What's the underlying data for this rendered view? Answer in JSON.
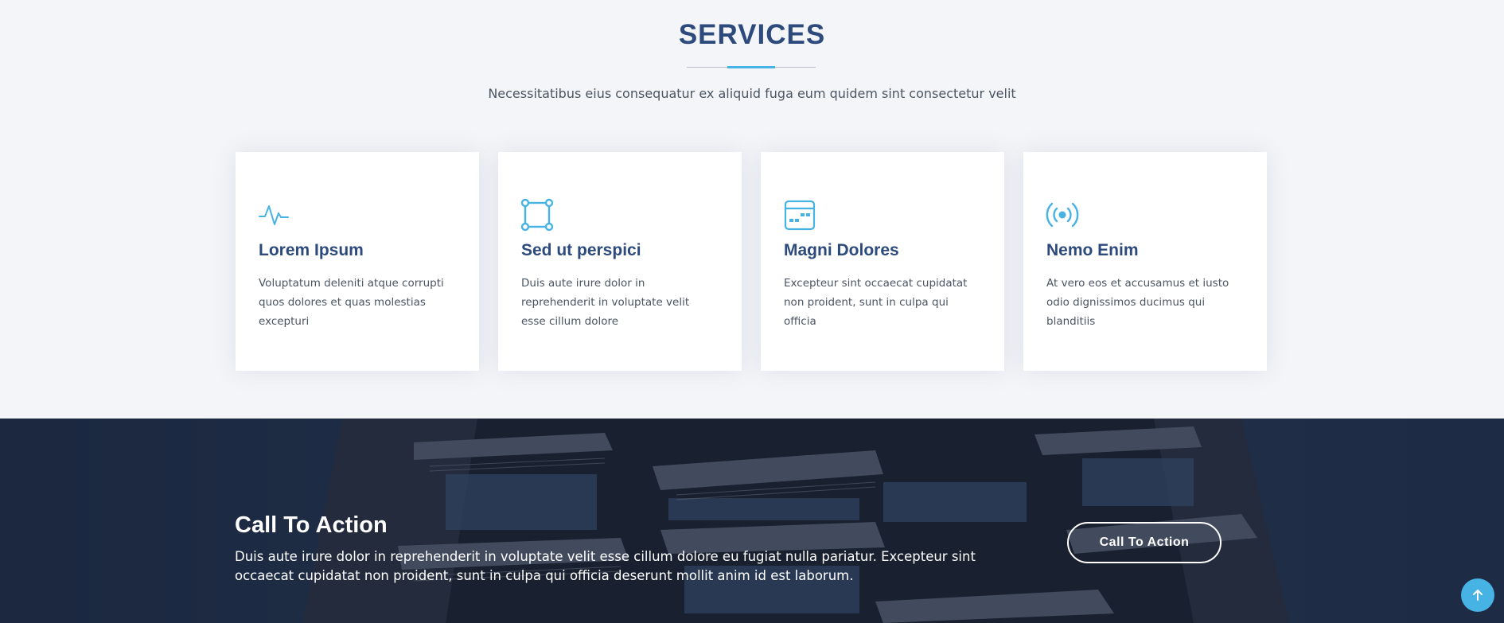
{
  "services": {
    "title": "SERVICES",
    "subtitle": "Necessitatibus eius consequatur ex aliquid fuga eum quidem sint consectetur velit",
    "accent_color": "#47b2e4",
    "title_color": "#2c4a7c",
    "cards": [
      {
        "icon": "activity-icon",
        "title": "Lorem Ipsum",
        "text": "Voluptatum deleniti atque corrupti quos dolores et quas molestias excepturi"
      },
      {
        "icon": "bounding-box-icon",
        "title": "Sed ut perspici",
        "text": "Duis aute irure dolor in reprehenderit in voluptate velit esse cillum dolore"
      },
      {
        "icon": "calendar-icon",
        "title": "Magni Dolores",
        "text": "Excepteur sint occaecat cupidatat non proident, sunt in culpa qui officia"
      },
      {
        "icon": "broadcast-icon",
        "title": "Nemo Enim",
        "text": "At vero eos et accusamus et iusto odio dignissimos ducimus qui blanditiis"
      }
    ]
  },
  "cta": {
    "title": "Call To Action",
    "text": "Duis aute irure dolor in reprehenderit in voluptate velit esse cillum dolore eu fugiat nulla pariatur. Excepteur sint occaecat cupidatat non proident, sunt in culpa qui officia deserunt mollit anim id est laborum.",
    "button_label": "Call To Action",
    "background_color": "#263753"
  },
  "back_to_top": {
    "icon": "arrow-up-icon",
    "color": "#47b2e4"
  }
}
